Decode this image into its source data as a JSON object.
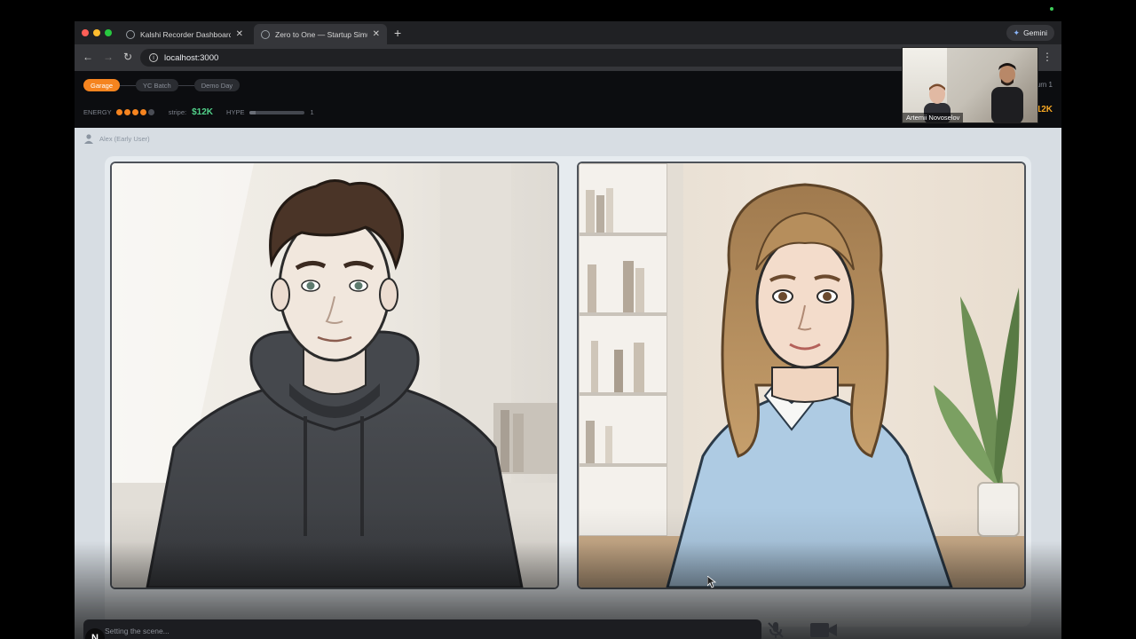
{
  "browser": {
    "tabs": [
      {
        "title": "Kalshi Recorder Dashboard",
        "active": false
      },
      {
        "title": "Zero to One — Startup Simulator",
        "active": true
      }
    ],
    "address": "localhost:3000",
    "gemini_label": "Gemini"
  },
  "game": {
    "stages": [
      "Garage",
      "YC Batch",
      "Demo Day"
    ],
    "current_stage": "Garage",
    "turn_label": "Turn 1",
    "energy_label": "ENERGY",
    "energy_level": 4,
    "energy_max": 5,
    "stripe_label": "stripe:",
    "stripe_value": "$12K",
    "hype_label": "HYPE",
    "hype_value": "1",
    "hype_fraction": 0.1,
    "cash_value": "$12K"
  },
  "pip": {
    "participant_name": "Artemii Novoselov"
  },
  "scene": {
    "speaker": "Alex (Early User)",
    "characters": [
      "founder-hoodie",
      "woman-sweater"
    ]
  },
  "composer": {
    "placeholder": "Setting the scene...",
    "badge": "N"
  },
  "colors": {
    "accent": "#f5841f",
    "stripe_green": "#52d18a",
    "cash_gold": "#f5a623"
  }
}
